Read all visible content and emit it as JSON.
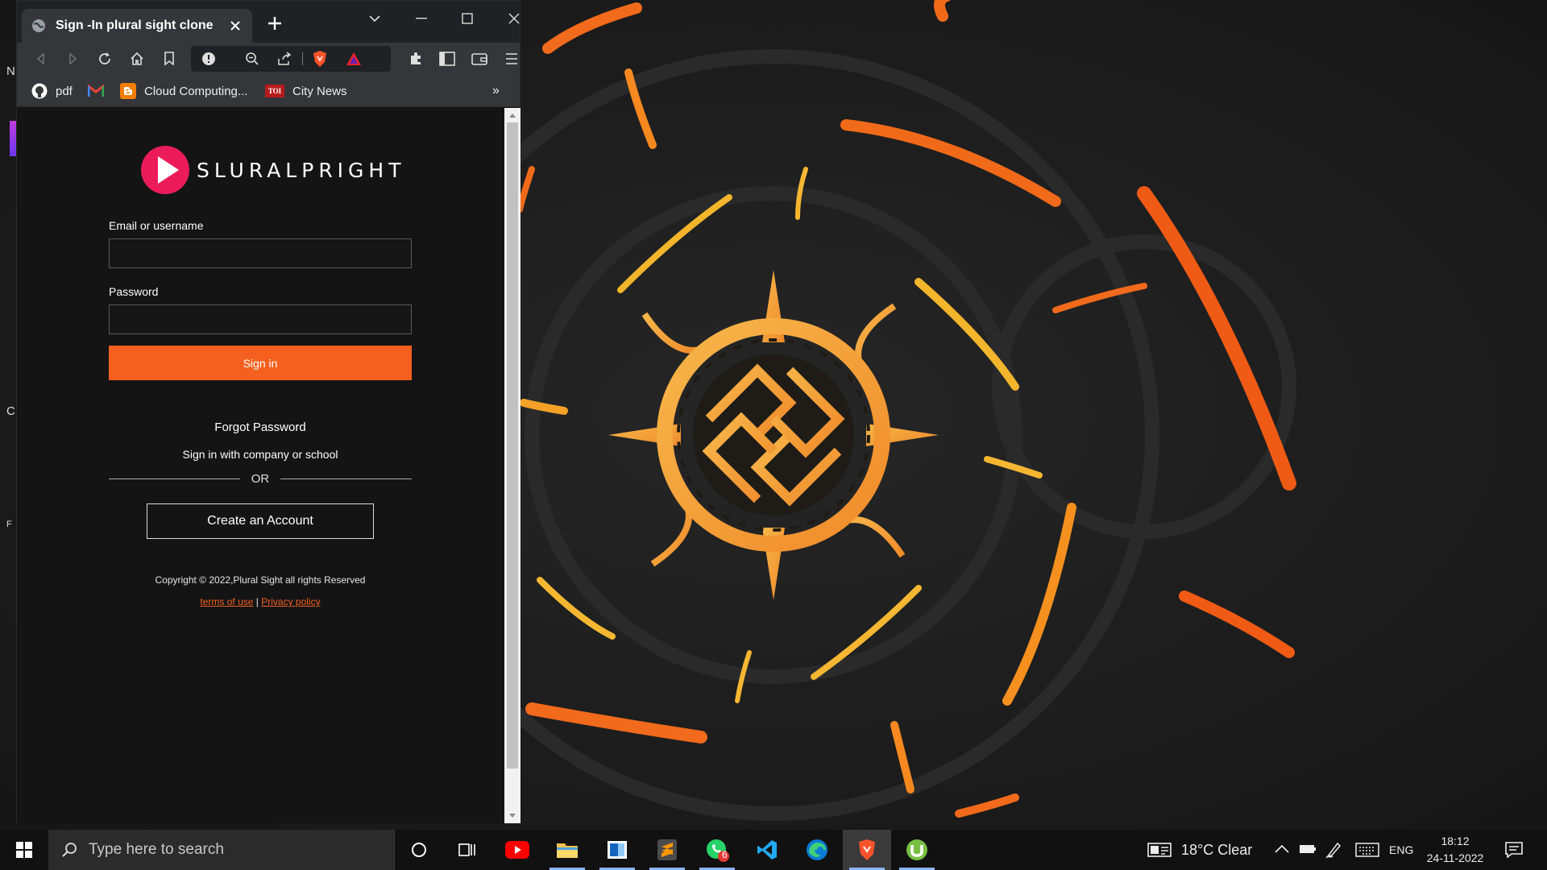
{
  "browser": {
    "tab_title": "Sign -In plural sight clone",
    "bookmarks": [
      {
        "label": "pdf",
        "icon": "github-icon"
      },
      {
        "label": "",
        "icon": "gmail-icon"
      },
      {
        "label": "Cloud Computing...",
        "icon": "blogger-icon"
      },
      {
        "label": "City News",
        "icon": "toi-icon",
        "badge": "TOI"
      }
    ],
    "bookmarks_overflow": "»"
  },
  "page": {
    "brand": "SLURALPRIGHT",
    "email_label": "Email or username",
    "email_value": "",
    "password_label": "Password",
    "password_value": "",
    "signin_label": "Sign in",
    "forgot_label": "Forgot Password",
    "company_label": "Sign in with company or school",
    "or_label": "OR",
    "create_label": "Create an Account",
    "copyright": "Copyright © 2022,Plural Sight all rights Reserved",
    "terms_label": "terms of use",
    "separator": "|",
    "privacy_label": "Privacy policy",
    "accent_color": "#f5601e"
  },
  "desktop": {
    "fragments": [
      "N",
      "C",
      "F"
    ]
  },
  "taskbar": {
    "search_placeholder": "Type here to search",
    "whatsapp_badge": "6",
    "weather": "18°C  Clear",
    "language": "ENG",
    "time": "18:12",
    "date": "24-11-2022"
  }
}
